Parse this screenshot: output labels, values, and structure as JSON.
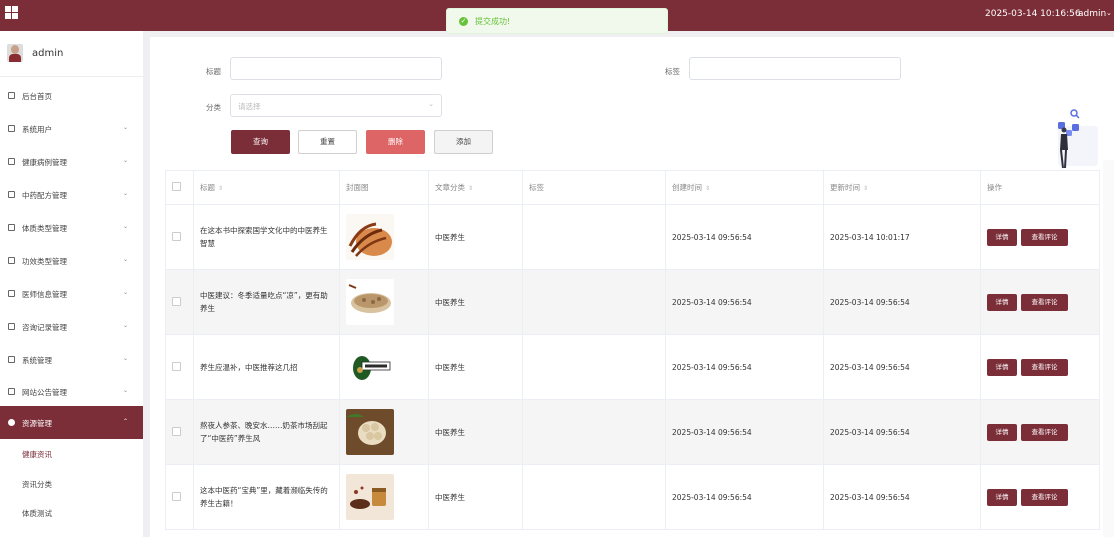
{
  "header": {
    "datetime": "2025-03-14 10:16:56",
    "user": "admin",
    "user_caret": "⌄"
  },
  "toast": {
    "icon": "✓",
    "text": "提交成功!"
  },
  "sidebar": {
    "user_name": "admin",
    "items": [
      {
        "label": "后台首页",
        "icon": "home-icon",
        "arrow": ""
      },
      {
        "label": "系统用户",
        "icon": "user-icon",
        "arrow": "⌄"
      },
      {
        "label": "健康病例管理",
        "icon": "document-icon",
        "arrow": "⌄"
      },
      {
        "label": "中药配方管理",
        "icon": "document-icon",
        "arrow": "⌄"
      },
      {
        "label": "体质类型管理",
        "icon": "document-icon",
        "arrow": "⌄"
      },
      {
        "label": "功效类型管理",
        "icon": "document-icon",
        "arrow": "⌄"
      },
      {
        "label": "医师信息管理",
        "icon": "document-icon",
        "arrow": "⌄"
      },
      {
        "label": "咨询记录管理",
        "icon": "document-icon",
        "arrow": "⌄"
      },
      {
        "label": "系统管理",
        "icon": "image-icon",
        "arrow": "⌄"
      },
      {
        "label": "网站公告管理",
        "icon": "info-icon",
        "arrow": "⌄"
      },
      {
        "label": "资源管理",
        "icon": "bulb-icon",
        "arrow": "⌃"
      }
    ],
    "sub_items": [
      {
        "label": "健康资讯"
      },
      {
        "label": "资讯分类"
      },
      {
        "label": "体质测试"
      }
    ]
  },
  "filters": {
    "title_label": "标题",
    "title_value": "",
    "tag_label": "标签",
    "tag_value": "",
    "category_label": "分类",
    "category_placeholder": "请选择",
    "caret": "⌄"
  },
  "buttons": {
    "query": "查询",
    "reset": "重置",
    "delete": "删除",
    "add": "添加"
  },
  "table": {
    "columns": [
      "",
      "标题",
      "封面图",
      "文章分类",
      "标签",
      "创建时间",
      "更新时间",
      "操作"
    ],
    "sortable": [
      false,
      true,
      false,
      true,
      false,
      true,
      true,
      false
    ],
    "sort_glyph": "⇕",
    "action_detail": "详情",
    "action_comments": "查看评论",
    "rows": [
      {
        "title": "在这本书中探索国学文化中的中医养生智慧",
        "category": "中医养生",
        "tag": "",
        "created": "2025-03-14 09:56:54",
        "updated": "2025-03-14 10:01:17"
      },
      {
        "title": "中医建议：冬季适量吃点“凉”，更有助养生",
        "category": "中医养生",
        "tag": "",
        "created": "2025-03-14 09:56:54",
        "updated": "2025-03-14 09:56:54"
      },
      {
        "title": "养生应温补，中医推荐这几招",
        "category": "中医养生",
        "tag": "",
        "created": "2025-03-14 09:56:54",
        "updated": "2025-03-14 09:56:54"
      },
      {
        "title": "熬夜人参茶、晚安水……奶茶市场刮起了“中医药”养生风",
        "category": "中医养生",
        "tag": "",
        "created": "2025-03-14 09:56:54",
        "updated": "2025-03-14 09:56:54"
      },
      {
        "title": "这本中医药“宝典”里，藏着濒临失传的养生古籍！",
        "category": "中医养生",
        "tag": "",
        "created": "2025-03-14 09:56:54",
        "updated": "2025-03-14 09:56:54"
      }
    ]
  },
  "colors": {
    "brand": "#7b2d38",
    "danger": "#dd6566",
    "success": "#67c23a"
  }
}
